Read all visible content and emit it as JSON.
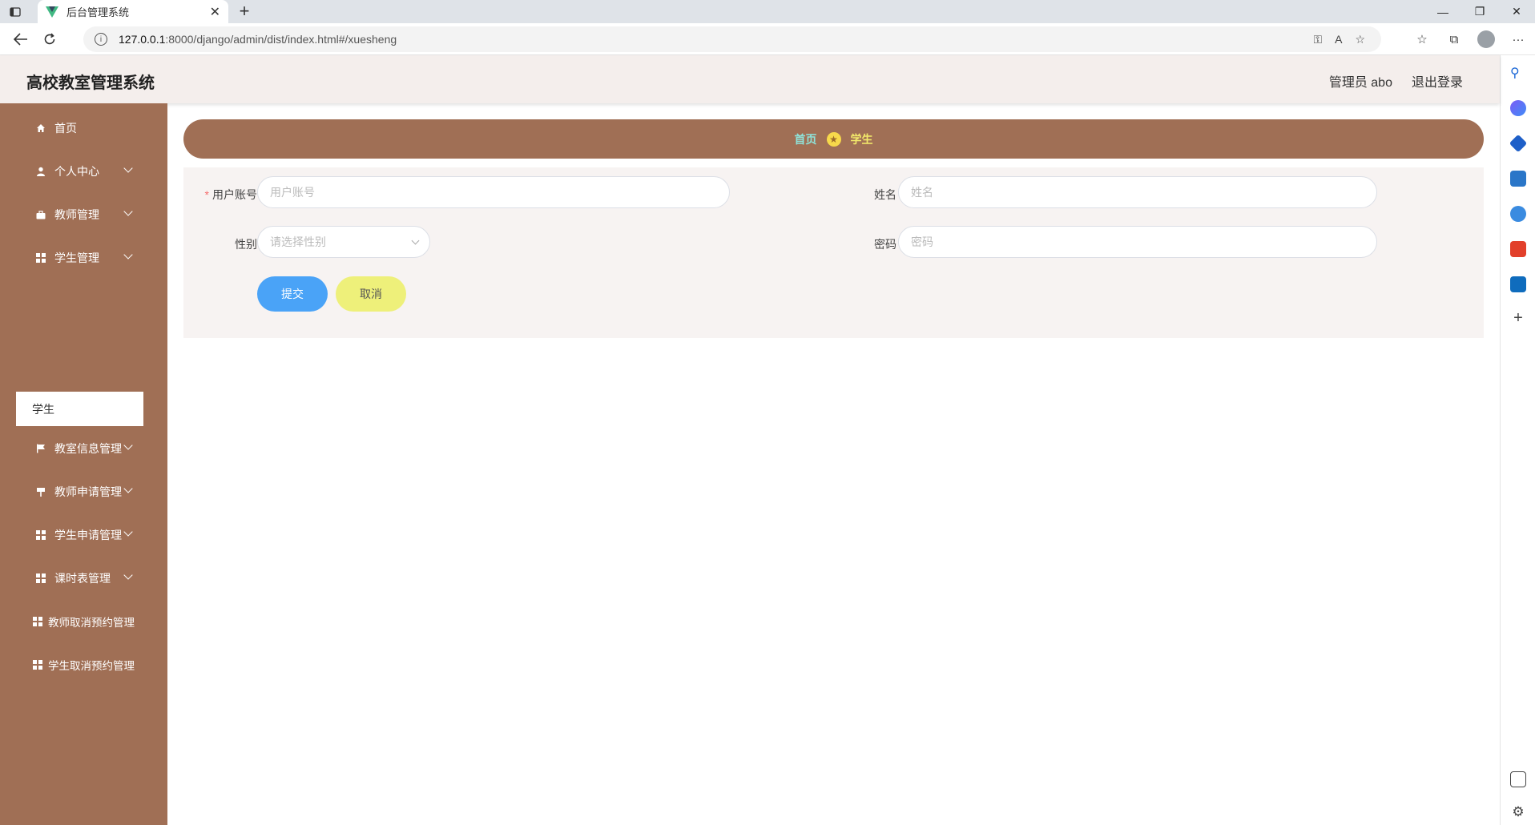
{
  "browser": {
    "tab_title": "后台管理系统",
    "url": "127.0.0.1:8000/django/admin/dist/index.html#/xuesheng",
    "url_prefix": "127.0.0.1",
    "url_rest": ":8000/django/admin/dist/index.html#/xuesheng"
  },
  "header": {
    "title": "高校教室管理系统",
    "user": "管理员 abo",
    "logout": "退出登录"
  },
  "sidebar": {
    "items": [
      {
        "label": "首页"
      },
      {
        "label": "个人中心"
      },
      {
        "label": "教师管理"
      },
      {
        "label": "学生管理"
      },
      {
        "label": "教室信息管理"
      },
      {
        "label": "教师申请管理"
      },
      {
        "label": "学生申请管理"
      },
      {
        "label": "课时表管理"
      },
      {
        "label": "教师取消预约管理"
      },
      {
        "label": "学生取消预约管理"
      }
    ],
    "active_sub": "学生"
  },
  "breadcrumb": {
    "home": "首页",
    "current": "学生"
  },
  "form": {
    "username_label": "用户账号",
    "username_placeholder": "用户账号",
    "name_label": "姓名",
    "name_placeholder": "姓名",
    "gender_label": "性别",
    "gender_placeholder": "请选择性别",
    "password_label": "密码",
    "password_placeholder": "密码",
    "submit": "提交",
    "cancel": "取消"
  },
  "colors": {
    "sidebar": "#a06f55",
    "header": "#f4eeec",
    "submit": "#4aa3f7",
    "cancel": "#eef07a"
  }
}
